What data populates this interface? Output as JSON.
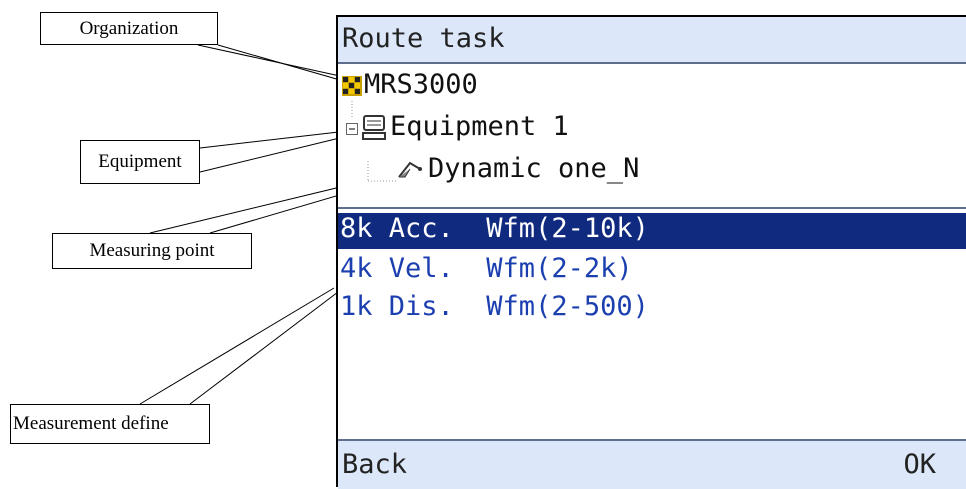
{
  "callouts": {
    "organization": "Organization",
    "equipment": "Equipment",
    "measuring_point": "Measuring point",
    "measurement_define": "Measurement define"
  },
  "screen": {
    "title": "Route task",
    "tree": {
      "organization": "MRS3000",
      "equipment": "Equipment 1",
      "measuring_point": "Dynamic one_N"
    },
    "measurements": [
      {
        "label": "8k Acc.  Wfm(2-10k)",
        "selected": true
      },
      {
        "label": "4k Vel.  Wfm(2-2k)",
        "selected": false
      },
      {
        "label": "1k Dis.  Wfm(2-500)",
        "selected": false
      }
    ],
    "footer": {
      "left": "Back",
      "right": "OK"
    }
  },
  "colors": {
    "title_bar": "#dce8fa",
    "selected_row": "#102a80",
    "list_text": "#1c3fb0"
  },
  "icons": {
    "organization": "grid-icon",
    "equipment": "monitor-icon",
    "collapse": "minus-box-icon",
    "measuring_point": "sensor-probe-icon"
  }
}
